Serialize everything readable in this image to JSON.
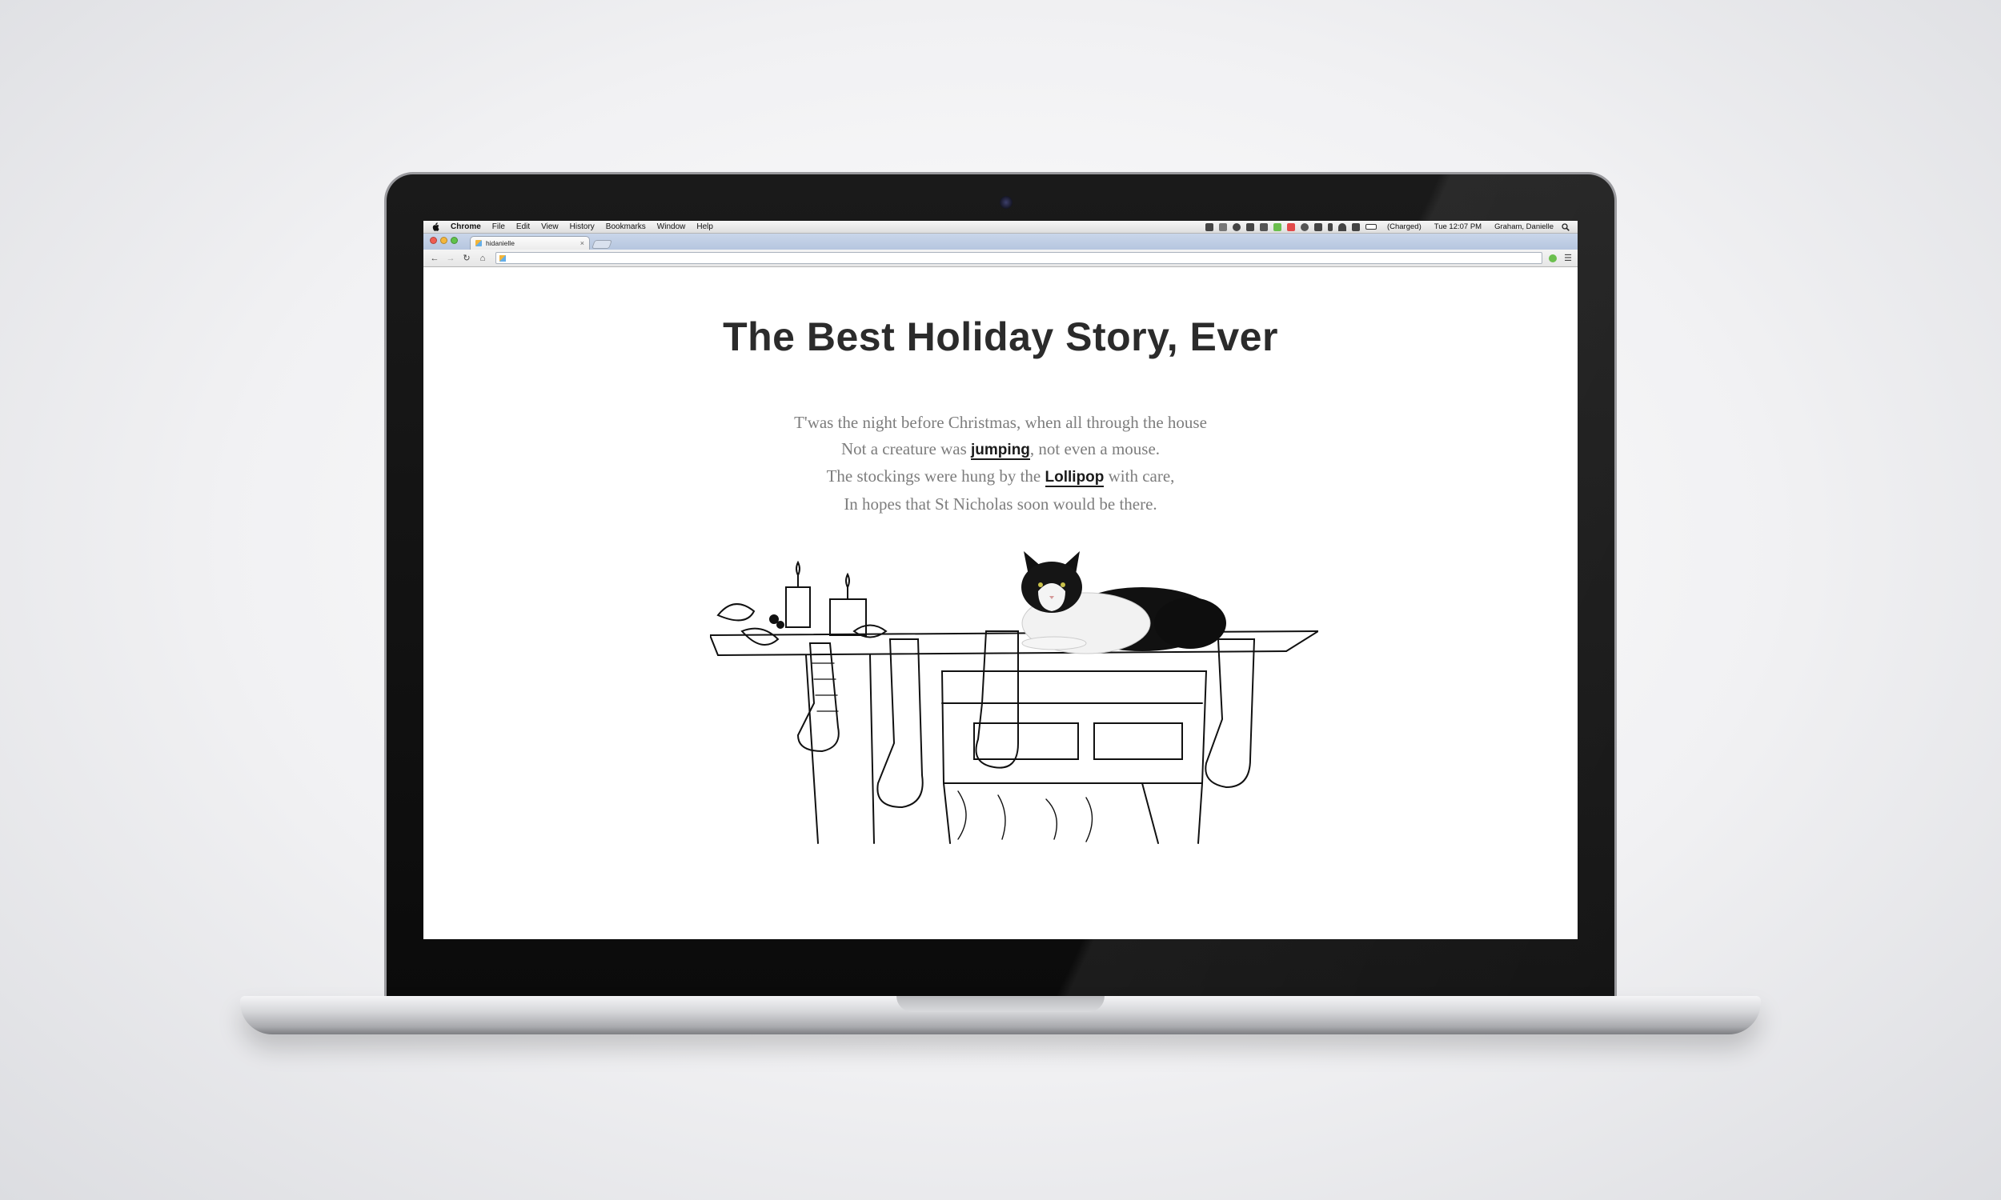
{
  "menubar": {
    "app_name": "Chrome",
    "items": [
      "File",
      "Edit",
      "View",
      "History",
      "Bookmarks",
      "Window",
      "Help"
    ],
    "battery_status": "(Charged)",
    "clock": "Tue 12:07 PM",
    "user": "Graham, Danielle"
  },
  "browser": {
    "tab_title": "hidanielle",
    "tab_close": "×",
    "url": ""
  },
  "page": {
    "title": "The Best Holiday Story, Ever",
    "poem": {
      "line1": "T'was the night before Christmas, when all through the house",
      "line2_pre": "Not a creature was ",
      "line2_link": "jumping",
      "line2_post": ", not even a mouse.",
      "line3_pre": "The stockings were hung by the ",
      "line3_link": "Lollipop",
      "line3_post": " with care,",
      "line4": "In hopes that St Nicholas soon would be there."
    }
  },
  "icons": [
    "apple-icon",
    "search-icon",
    "back-icon",
    "forward-icon",
    "reload-icon",
    "home-icon",
    "menu-icon"
  ],
  "colors": {
    "text_dark": "#2b2b2b",
    "poem_gray": "#7d7d7d",
    "tab_strip": "#b6c6df"
  }
}
